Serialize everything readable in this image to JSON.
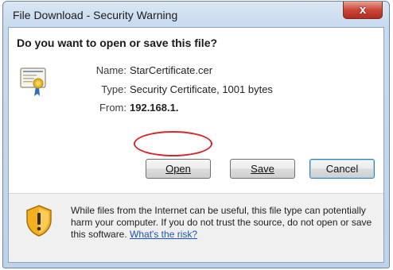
{
  "window": {
    "title": "File Download - Security Warning",
    "close_glyph": "x"
  },
  "dialog": {
    "question": "Do you want to open or save this file?",
    "file_icon": "certificate-icon",
    "info": {
      "name_label": "Name:",
      "name_value": "StarCertificate.cer",
      "type_label": "Type:",
      "type_value": "Security Certificate, 1001 bytes",
      "from_label": "From:",
      "from_value": "192.168.1."
    },
    "buttons": {
      "open": "Open",
      "save": "Save",
      "cancel": "Cancel"
    },
    "highlight_color": "#d5262b"
  },
  "warning": {
    "icon": "shield-warning-icon",
    "text": "While files from the Internet can be useful, this file type can potentially harm your computer. If you do not trust the source, do not open or save this software.",
    "link": "What's the risk?"
  }
}
